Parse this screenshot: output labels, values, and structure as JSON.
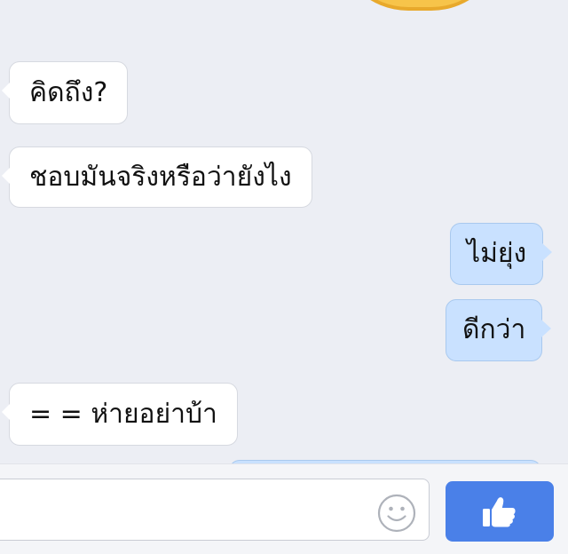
{
  "chat": {
    "messages": [
      {
        "direction": "incoming",
        "text": "คิดถึง?"
      },
      {
        "direction": "incoming",
        "text": "ชอบมันจริงหรือว่ายังไง"
      },
      {
        "direction": "outgoing",
        "text": "ไม่ยุ่ง"
      },
      {
        "direction": "outgoing",
        "text": "ดีกว่า"
      },
      {
        "direction": "incoming",
        "text": "= = ห่ายอย่าบ้า"
      }
    ]
  },
  "composer": {
    "input_value": "",
    "emoji_icon": "smiley-face-icon",
    "like_icon": "thumbs-up-icon"
  },
  "colors": {
    "background": "#eceef4",
    "incoming_bubble": "#ffffff",
    "outgoing_bubble": "#c9e1ff",
    "like_button": "#4a80e8",
    "sticker": "#f7c44a"
  }
}
